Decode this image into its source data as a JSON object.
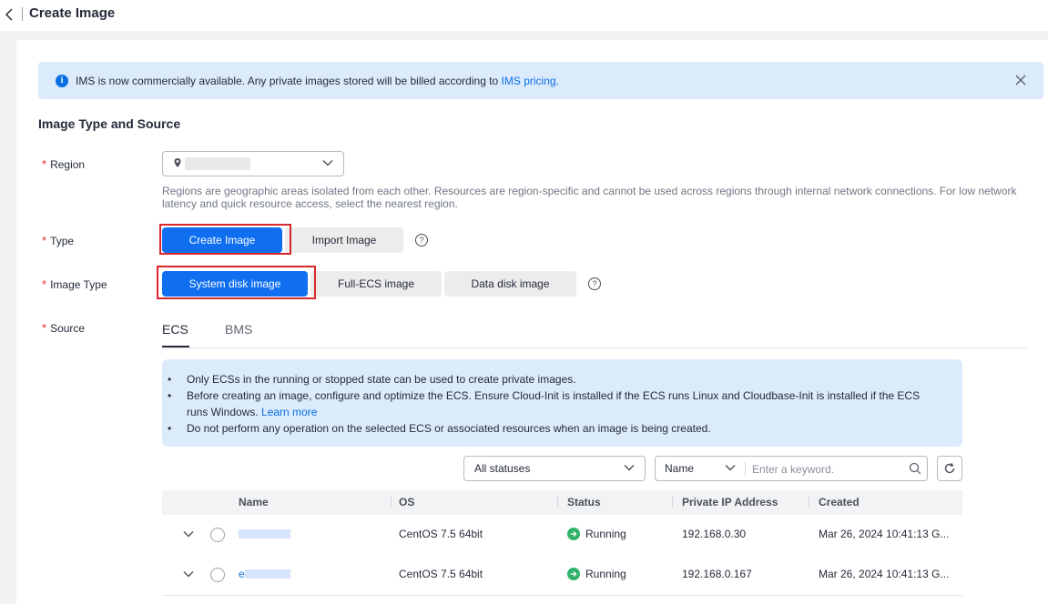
{
  "header": {
    "title": "Create Image"
  },
  "notice": {
    "text": "IMS is now commercially available. Any private images stored will be billed according to ",
    "link": "IMS pricing."
  },
  "section": {
    "title": "Image Type and Source"
  },
  "form": {
    "region": {
      "label": "Region",
      "hint": "Regions are geographic areas isolated from each other. Resources are region-specific and cannot be used across regions through internal network connections. For low network latency and quick resource access, select the nearest region."
    },
    "type": {
      "label": "Type",
      "options": [
        "Create Image",
        "Import Image"
      ],
      "selected": "Create Image"
    },
    "image_type": {
      "label": "Image Type",
      "options": [
        "System disk image",
        "Full-ECS image",
        "Data disk image"
      ],
      "selected": "System disk image"
    },
    "source": {
      "label": "Source",
      "tabs": [
        "ECS",
        "BMS"
      ],
      "active_tab": "ECS"
    }
  },
  "tips": {
    "items": [
      "Only ECSs in the running or stopped state can be used to create private images.",
      "Before creating an image, configure and optimize the ECS. Ensure Cloud-Init is installed if the ECS runs Linux and Cloudbase-Init is installed if the ECS runs Windows. ",
      "Do not perform any operation on the selected ECS or associated resources when an image is being created."
    ],
    "learn_more": "Learn more"
  },
  "filters": {
    "status": "All statuses",
    "search_field": "Name",
    "search_placeholder": "Enter a keyword."
  },
  "table": {
    "columns": [
      "Name",
      "OS",
      "Status",
      "Private IP Address",
      "Created"
    ],
    "rows": [
      {
        "name_prefix": "",
        "os": "CentOS 7.5 64bit",
        "status": "Running",
        "ip": "192.168.0.30",
        "created": "Mar 26, 2024 10:41:13 G..."
      },
      {
        "name_prefix": "e",
        "os": "CentOS 7.5 64bit",
        "status": "Running",
        "ip": "192.168.0.167",
        "created": "Mar 26, 2024 10:41:13 G..."
      }
    ]
  },
  "colors": {
    "accent": "#0f6ff0",
    "highlight_border": "#d9262c",
    "running": "#2fb268",
    "notice_bg": "#dbebfc"
  }
}
